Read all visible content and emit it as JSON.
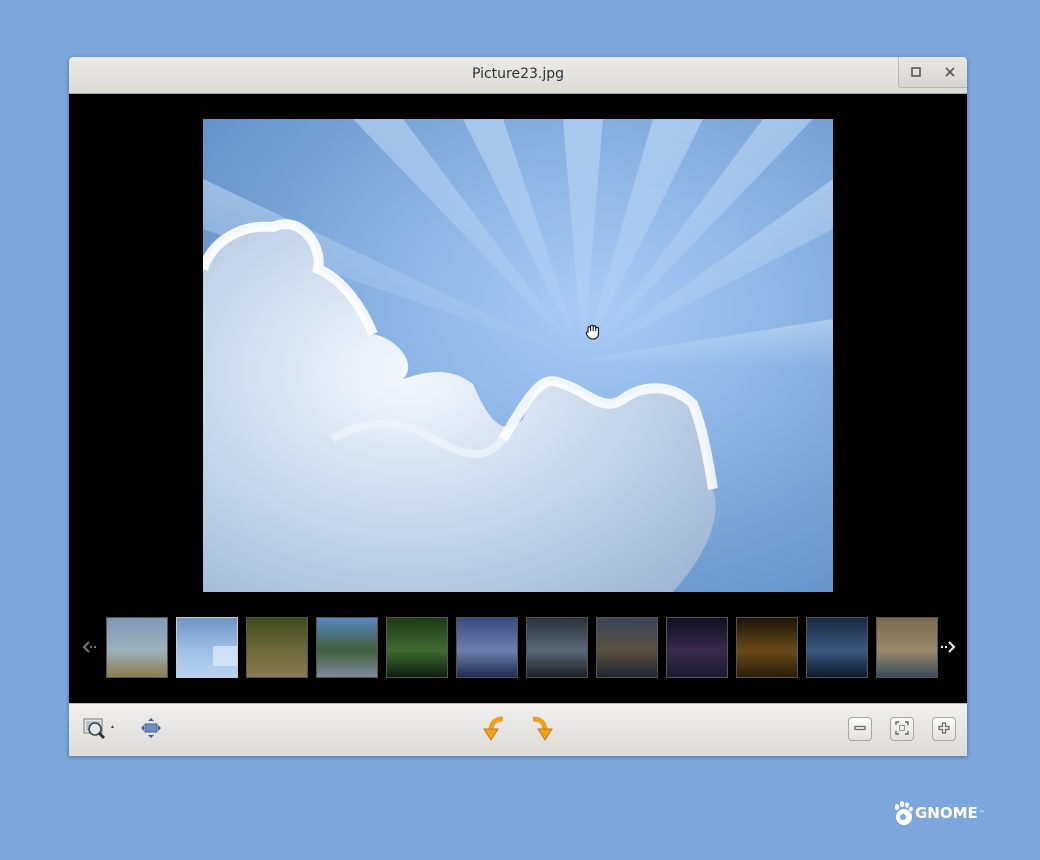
{
  "window": {
    "title": "Picture23.jpg",
    "maximize_icon": "maximize-icon",
    "close_icon": "close-icon"
  },
  "viewer": {
    "current_image": "Picture23.jpg",
    "cursor": "grab-hand-icon"
  },
  "filmstrip": {
    "prev_icon": "arrow-left-icon",
    "next_icon": "arrow-right-icon",
    "thumbnails": [
      {
        "name": "thumb-meadow",
        "colors": [
          "#7f98b8",
          "#9eb0bd",
          "#8a7d4a"
        ]
      },
      {
        "name": "thumb-sunrays",
        "colors": [
          "#6f95c4",
          "#9ec0e6",
          "#b8d4f2"
        ],
        "selected": true
      },
      {
        "name": "thumb-forest-path",
        "colors": [
          "#3f4a1c",
          "#6f6a3a",
          "#8a7a50"
        ]
      },
      {
        "name": "thumb-rocky-shore",
        "colors": [
          "#5a87c0",
          "#3f5f3a",
          "#7f8aa0"
        ]
      },
      {
        "name": "thumb-green-valley",
        "colors": [
          "#1e3a1a",
          "#3f6a30",
          "#0e1e0e"
        ]
      },
      {
        "name": "thumb-city-dusk",
        "colors": [
          "#3a4a80",
          "#6f7fb0",
          "#1e2a50"
        ]
      },
      {
        "name": "thumb-light-beams",
        "colors": [
          "#2a3038",
          "#5a6a78",
          "#1a1e24"
        ]
      },
      {
        "name": "thumb-night-road",
        "colors": [
          "#3a4658",
          "#5a5040",
          "#1e2430"
        ]
      },
      {
        "name": "thumb-skyline-night",
        "colors": [
          "#0e1020",
          "#3a2a4a",
          "#1a1a30"
        ]
      },
      {
        "name": "thumb-city-lights",
        "colors": [
          "#1a1408",
          "#6a4a18",
          "#2a1e0a"
        ]
      },
      {
        "name": "thumb-blue-trees",
        "colors": [
          "#1a2a40",
          "#3a5a80",
          "#0e1a2a"
        ]
      },
      {
        "name": "thumb-grassland",
        "colors": [
          "#7a6a50",
          "#9a8a6a",
          "#3a4a5a"
        ]
      }
    ]
  },
  "toolbar": {
    "image_menu_icon": "image-magnifier-icon",
    "fit_icon": "fit-arrows-icon",
    "rotate_left_icon": "rotate-left-icon",
    "rotate_right_icon": "rotate-right-icon",
    "zoom_out_icon": "zoom-out-icon",
    "best_fit_icon": "best-fit-icon",
    "zoom_in_icon": "zoom-in-icon"
  },
  "branding": {
    "logo_text": "GNOME",
    "trademark": "™"
  },
  "colors": {
    "desktop": "#7ba7dd",
    "rotate_arrow": "#f0a020"
  }
}
